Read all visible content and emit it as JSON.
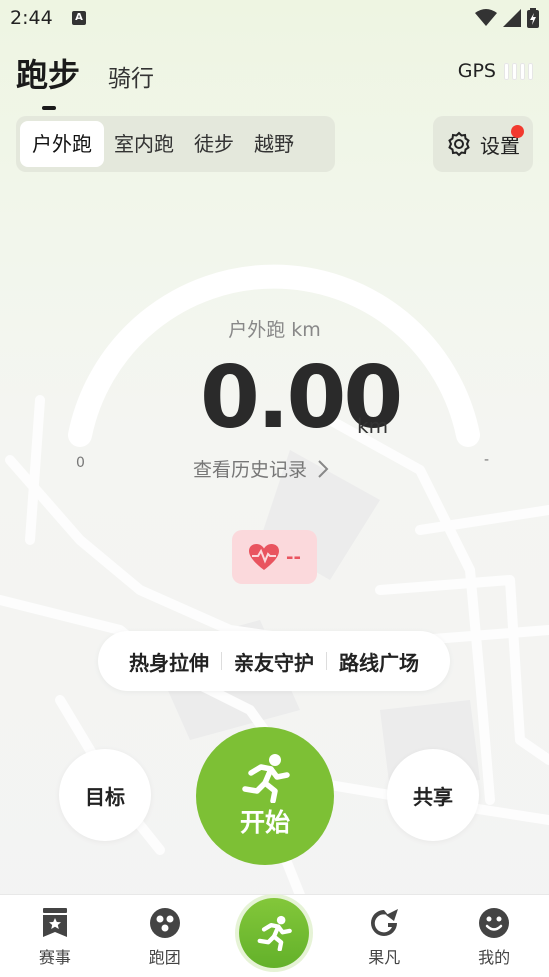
{
  "status_bar": {
    "time": "2:44",
    "badge": "A"
  },
  "header": {
    "tabs": [
      {
        "label": "跑步",
        "active": true
      },
      {
        "label": "骑行",
        "active": false
      }
    ],
    "gps_label": "GPS"
  },
  "sport_types": {
    "items": [
      {
        "label": "户外跑",
        "active": true
      },
      {
        "label": "室内跑",
        "active": false
      },
      {
        "label": "徒步",
        "active": false
      },
      {
        "label": "越野",
        "active": false
      }
    ]
  },
  "settings": {
    "label": "设置",
    "has_notification": true
  },
  "dashboard": {
    "sport_label": "户外跑  km",
    "distance": "0.00",
    "unit": "km",
    "min_label": "0",
    "max_label": "-",
    "history_link": "查看历史记录"
  },
  "heart_rate": {
    "value": "--"
  },
  "features": [
    "热身拉伸",
    "亲友守护",
    "路线广场"
  ],
  "actions": {
    "goal": "目标",
    "start": "开始",
    "share": "共享"
  },
  "bottom_nav": {
    "items": [
      "赛事",
      "跑团",
      "",
      "果凡",
      "我的"
    ]
  },
  "colors": {
    "accent": "#7dc035",
    "heart": "#e9545f",
    "notification": "#f23a2f"
  }
}
